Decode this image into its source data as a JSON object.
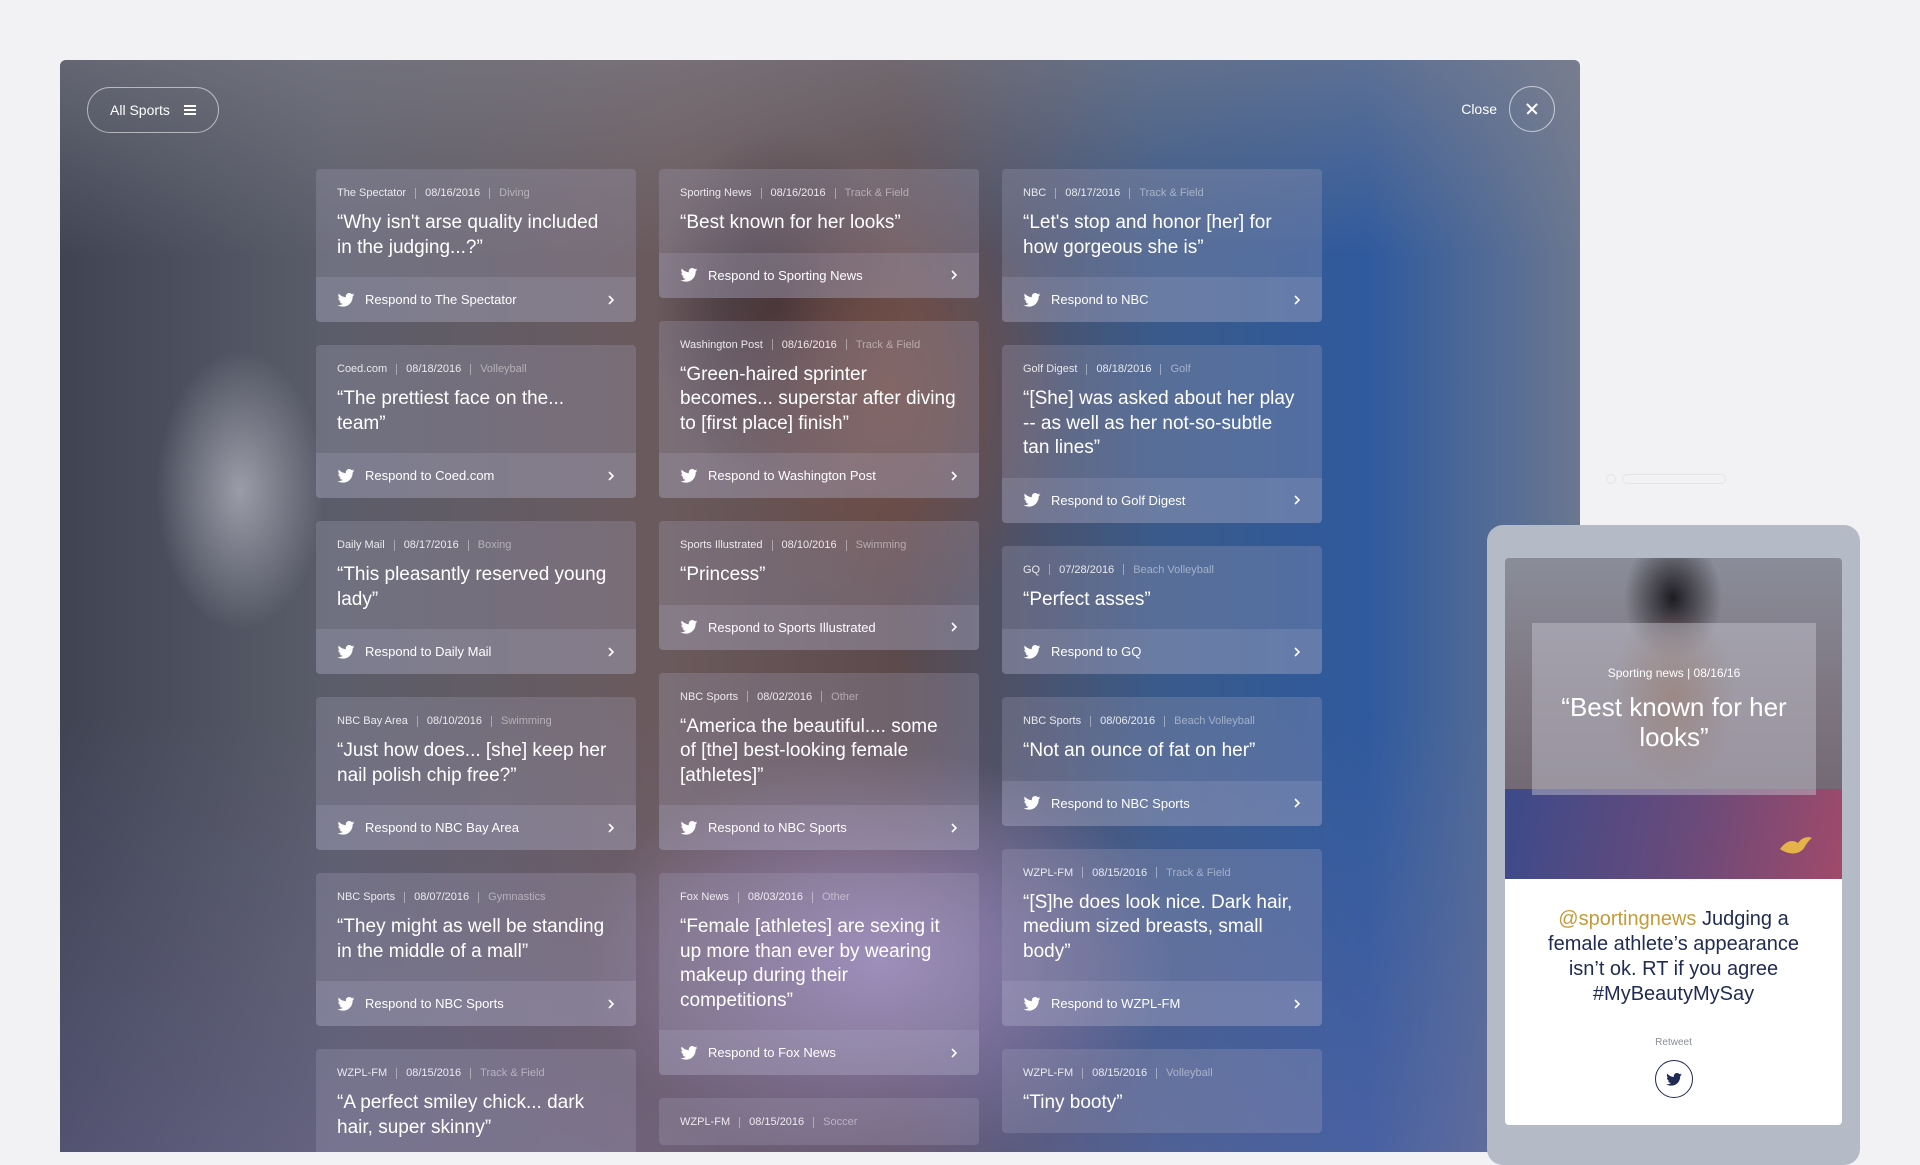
{
  "toolbar": {
    "filter_label": "All Sports",
    "close_label": "Close"
  },
  "columns": [
    [
      {
        "source": "The Spectator",
        "date": "08/16/2016",
        "category": "Diving",
        "quote": "“Why isn't arse quality included in the judging...?”",
        "respond": "Respond to The Spectator"
      },
      {
        "source": "Coed.com",
        "date": "08/18/2016",
        "category": "Volleyball",
        "quote": "“The prettiest face on the... team”",
        "respond": "Respond to Coed.com"
      },
      {
        "source": "Daily Mail",
        "date": "08/17/2016",
        "category": "Boxing",
        "quote": "“This pleasantly reserved young lady”",
        "respond": "Respond to Daily Mail"
      },
      {
        "source": "NBC Bay Area",
        "date": "08/10/2016",
        "category": "Swimming",
        "quote": "“Just how does... [she] keep her nail polish chip free?”",
        "respond": "Respond to NBC Bay Area"
      },
      {
        "source": "NBC Sports",
        "date": "08/07/2016",
        "category": "Gymnastics",
        "quote": "“They might as well be standing in the middle of a mall”",
        "respond": "Respond to NBC Sports"
      },
      {
        "source": "WZPL-FM",
        "date": "08/15/2016",
        "category": "Track & Field",
        "quote": "“A perfect smiley chick... dark hair, super skinny”",
        "respond": ""
      }
    ],
    [
      {
        "source": "Sporting News",
        "date": "08/16/2016",
        "category": "Track & Field",
        "quote": "“Best known for her looks”",
        "respond": "Respond to Sporting News"
      },
      {
        "source": "Washington Post",
        "date": "08/16/2016",
        "category": "Track & Field",
        "quote": "“Green-haired sprinter becomes... superstar after diving to [first place] finish”",
        "respond": "Respond to Washington Post"
      },
      {
        "source": "Sports Illustrated",
        "date": "08/10/2016",
        "category": "Swimming",
        "quote": "“Princess”",
        "respond": "Respond to Sports Illustrated"
      },
      {
        "source": "NBC Sports",
        "date": "08/02/2016",
        "category": "Other",
        "quote": "“America the beautiful.... some of [the] best-looking female [athletes]”",
        "respond": "Respond to NBC Sports"
      },
      {
        "source": "Fox News",
        "date": "08/03/2016",
        "category": "Other",
        "quote": "“Female [athletes] are sexing it up more than ever by wearing makeup during their competitions”",
        "respond": "Respond to Fox News"
      },
      {
        "source": "WZPL-FM",
        "date": "08/15/2016",
        "category": "Soccer",
        "quote": "",
        "respond": ""
      }
    ],
    [
      {
        "source": "NBC",
        "date": "08/17/2016",
        "category": "Track & Field",
        "quote": "“Let's stop and honor [her] for how gorgeous she is”",
        "respond": "Respond to NBC"
      },
      {
        "source": "Golf Digest",
        "date": "08/18/2016",
        "category": "Golf",
        "quote": "“[She] was asked about her play -- as well as her not-so-subtle tan lines”",
        "respond": "Respond to Golf Digest"
      },
      {
        "source": "GQ",
        "date": "07/28/2016",
        "category": "Beach Volleyball",
        "quote": "“Perfect asses”",
        "respond": "Respond to GQ"
      },
      {
        "source": "NBC Sports",
        "date": "08/06/2016",
        "category": "Beach Volleyball",
        "quote": "“Not an ounce of fat on her”",
        "respond": "Respond to NBC Sports"
      },
      {
        "source": "WZPL-FM",
        "date": "08/15/2016",
        "category": "Track & Field",
        "quote": "“[S]he does look nice. Dark hair, medium sized breasts, small body”",
        "respond": "Respond to WZPL-FM"
      },
      {
        "source": "WZPL-FM",
        "date": "08/15/2016",
        "category": "Volleyball",
        "quote": "“Tiny booty”",
        "respond": ""
      }
    ]
  ],
  "phone": {
    "meta": "Sporting news |  08/16/16",
    "quote": "“Best known for her looks”",
    "tweet_handle": "@sportingnews",
    "tweet_text": " Judging a female athlete’s appearance isn’t ok. RT if you agree #MyBeautyMySay",
    "retweet_label": "Retweet",
    "accent_color": "#c79a3a",
    "brand_color": "#1f2a55"
  }
}
